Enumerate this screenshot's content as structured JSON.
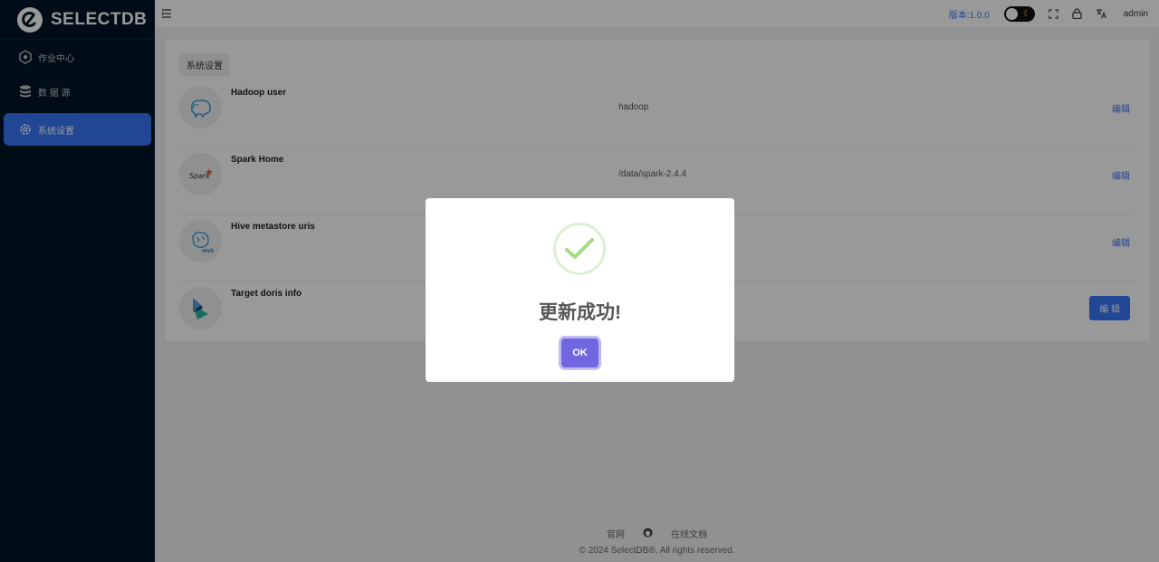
{
  "brand": {
    "name": "SELECTDB"
  },
  "sidebar": {
    "items": [
      {
        "label": "作业中心",
        "icon": "cube-icon"
      },
      {
        "label": "数 据 源",
        "icon": "database-icon"
      },
      {
        "label": "系统设置",
        "icon": "gear-icon",
        "active": true
      }
    ]
  },
  "header": {
    "version": "版本:1.0.0",
    "user": "admin",
    "icons": [
      "theme-toggle",
      "fullscreen-icon",
      "lock-icon",
      "translate-icon"
    ]
  },
  "settings": {
    "section_title": "系统设置",
    "rows": [
      {
        "title": "Hadoop user",
        "value": "hadoop",
        "edit": "编辑",
        "icon": "hadoop-elephant-icon"
      },
      {
        "title": "Spark Home",
        "value": "/data/spark-2.4.4",
        "edit": "编辑",
        "icon": "spark-logo-icon"
      },
      {
        "title": "Hive metastore uris",
        "value": "",
        "edit": "编辑",
        "icon": "hive-logo-icon"
      },
      {
        "title": "Target doris info",
        "value": "",
        "edit": "编 辑",
        "icon": "doris-logo-icon"
      }
    ]
  },
  "footer": {
    "official_site": "官网",
    "docs": "在线文档",
    "copyright": "© 2024 SelectDB®. All rights reserved."
  },
  "modal": {
    "title": "更新成功!",
    "ok_label": "OK"
  },
  "colors": {
    "sidebar_bg": "#001529",
    "accent": "#3876f6",
    "ok_button": "#7066e0",
    "success": "#a5dc86"
  }
}
